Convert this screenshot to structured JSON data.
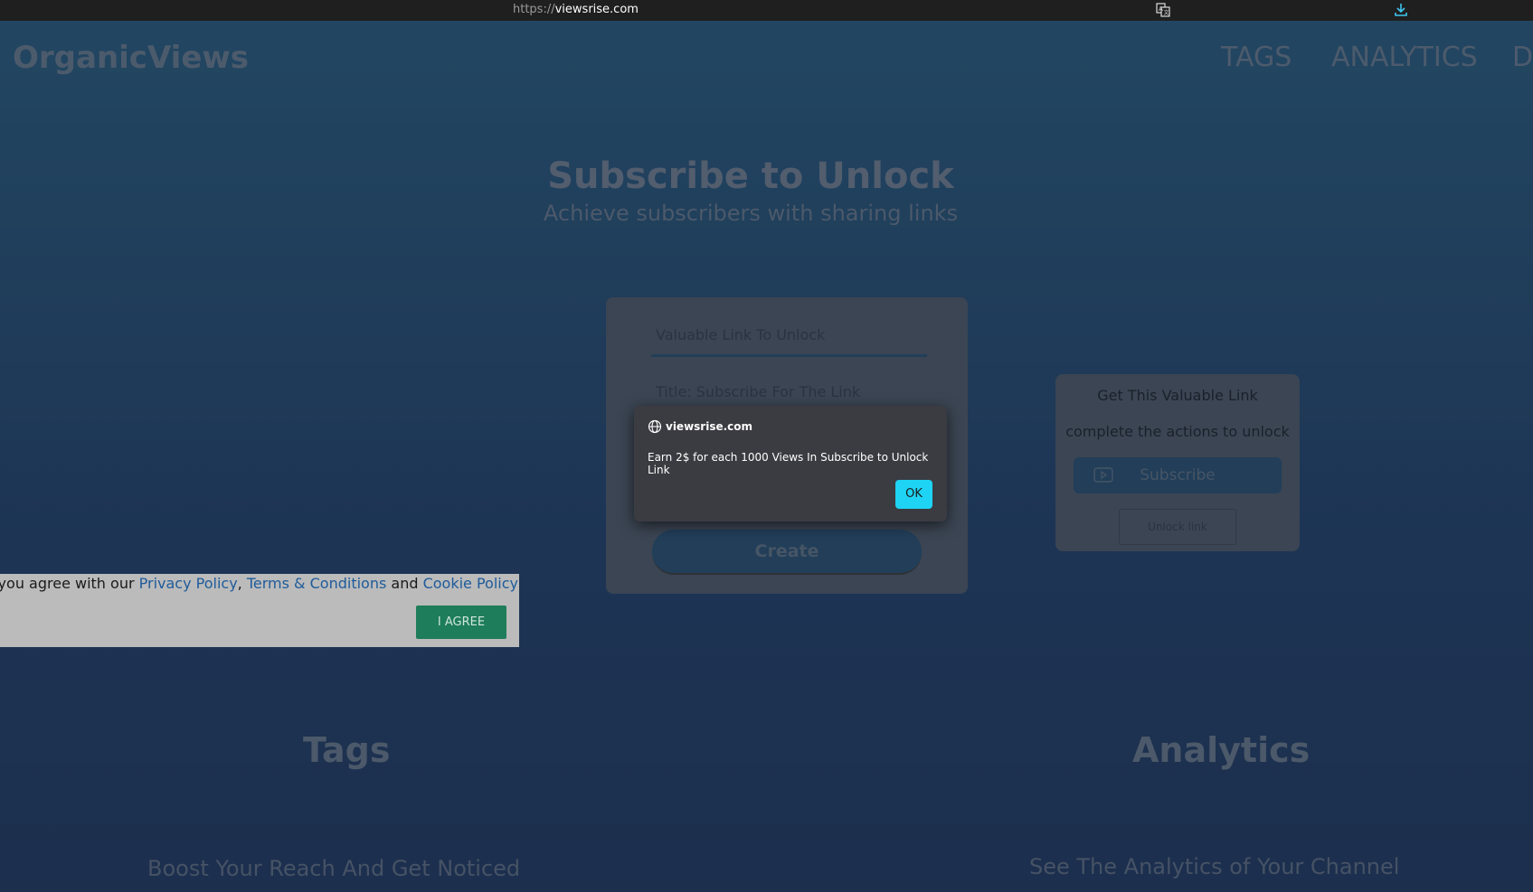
{
  "browser": {
    "url_scheme": "https://",
    "url_host": "viewsrise.com",
    "translate_icon": "translate-icon",
    "download_icon": "download-icon"
  },
  "header": {
    "brand": "OrganicViews",
    "nav": [
      "TAGS",
      "ANALYTICS",
      "D"
    ]
  },
  "hero": {
    "title": "Subscribe to Unlock",
    "subtitle": "Achieve subscribers with sharing links"
  },
  "form": {
    "link_placeholder": "Valuable Link To Unlock",
    "title_placeholder": "Title: Subscribe For The Link",
    "create_label": "Create"
  },
  "unlock_card": {
    "line1": "Get This Valuable Link",
    "line2": "complete the actions to unlock",
    "subscribe_label": "Subscribe",
    "subscribe_icon": "youtube-icon",
    "unlock_label": "Unlock link"
  },
  "sections": {
    "tags_title": "Tags",
    "tags_sub": "Boost Your Reach And Get Noticed",
    "analytics_title": "Analytics",
    "analytics_sub": "See The Analytics of Your Channel"
  },
  "alert": {
    "origin": "viewsrise.com",
    "icon": "globe-icon",
    "message": "Earn 2$ for each 1000 Views In Subscribe to Unlock Link",
    "ok_label": "OK"
  },
  "cookie": {
    "prefix": "s website you agree with our ",
    "privacy": "Privacy Policy",
    "comma": ", ",
    "terms": "Terms & Conditions",
    "and": " and ",
    "cookie_policy": "Cookie Policy",
    "agree_label": "I AGREE"
  },
  "colors": {
    "accent_ok": "#1ed3f3",
    "agree_green": "#1e7d5a",
    "link_blue": "#1e5b9a"
  }
}
